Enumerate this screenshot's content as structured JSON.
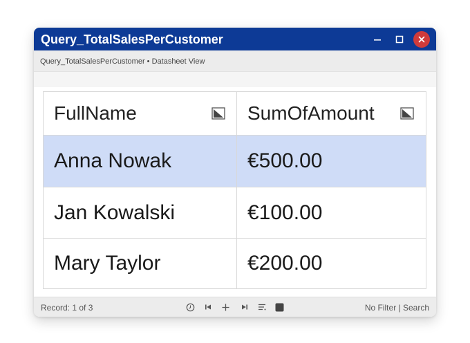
{
  "window": {
    "title": "Query_TotalSalesPerCustomer",
    "breadcrumb": "Query_TotalSalesPerCustomer • Datasheet View"
  },
  "table": {
    "columns": [
      "FullName",
      "SumOfAmount"
    ],
    "rows": [
      {
        "full_name": "Anna Nowak",
        "sum_of_amount": "€500.00",
        "selected": true
      },
      {
        "full_name": "Jan Kowalski",
        "sum_of_amount": "€100.00",
        "selected": false
      },
      {
        "full_name": "Mary Taylor",
        "sum_of_amount": "€200.00",
        "selected": false
      }
    ]
  },
  "status": {
    "record": "Record: 1 of 3",
    "filter_search": "No Filter | Search"
  },
  "icons": {
    "minimize": "minimize-icon",
    "maximize": "maximize-icon",
    "close": "close-icon",
    "sort": "sort-corner-icon",
    "history": "history-icon",
    "first": "first-record-icon",
    "new": "new-record-icon",
    "last": "last-record-icon",
    "filter": "filter-icon",
    "stop": "stop-icon"
  },
  "colors": {
    "title_bar": "#0d3a96",
    "selected_row": "#cfdcf7",
    "close_button": "#cf3b3b"
  }
}
